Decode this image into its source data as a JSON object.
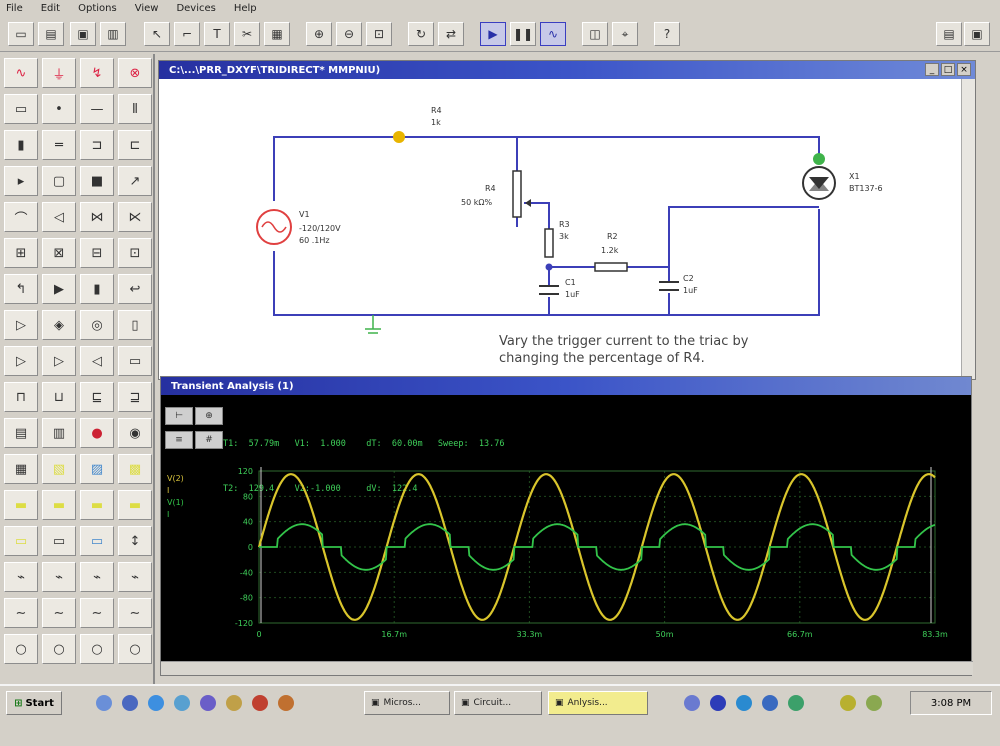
{
  "menu": [
    "File",
    "Edit",
    "Options",
    "View",
    "Devices",
    "Help"
  ],
  "schematic": {
    "title": "C:\\...\\PRR_DXYF\\TRIDIRECT* MMPNIU)",
    "note_line1": "Vary the trigger current to the triac by",
    "note_line2": "changing the percentage of R4.",
    "labels": {
      "v1_name": "V1",
      "v1_spec1": "-120/120V",
      "v1_spec2": "60 .1Hz",
      "r4_name": "R4",
      "r4_val": "1k",
      "pot_name": "R4",
      "pot_val": "50 kΩ%",
      "r3_name": "R3",
      "r3_val": "3k",
      "r2_name": "R2",
      "r2_val": "1.2k",
      "c1_name": "C1",
      "c1_val": "1uF",
      "c2_name": "C2",
      "c2_val": "1uF",
      "x1_name": "X1",
      "x1_part": "BT137-6"
    }
  },
  "analysis": {
    "title": "Transient Analysis (1)",
    "readout_line1": "T1:  57.79m   V1:  1.000    dT:  60.00m   Sweep:  13.76",
    "readout_line2": "T2:  129.4    V2:-1.000     dV:  122.4",
    "legend": [
      "V(2)",
      "I",
      "V(1)",
      "I"
    ],
    "y_ticks": [
      "120",
      "80",
      "40",
      "0",
      "-40",
      "-80",
      "-120"
    ],
    "x_ticks": [
      "0",
      "16.7m",
      "33.3m",
      "50m",
      "66.7m",
      "83.3m"
    ],
    "cursor_labels": [
      "1",
      "2"
    ]
  },
  "chart_data": {
    "type": "line",
    "x_unit": "s",
    "xlim": [
      0,
      0.0883
    ],
    "ylim": [
      -120,
      120
    ],
    "series": [
      {
        "name": "V(2)",
        "color": "#d9c52c",
        "kind": "sine",
        "amplitude": 115,
        "frequency_hz": 60
      },
      {
        "name": "V(1)",
        "color": "#33c44a",
        "kind": "triac",
        "amplitude": 40,
        "frequency_hz": 60
      }
    ]
  },
  "taskbar": {
    "start": "Start",
    "buttons": [
      "Micros...",
      "Circuit...",
      "Anlysis..."
    ],
    "clock": "3:08 PM"
  },
  "colors": {
    "wire": "#3c3fb8",
    "source": "#e04040",
    "junction": "#e8b400",
    "trace_yellow": "#d9c52c",
    "trace_green": "#33c44a"
  }
}
